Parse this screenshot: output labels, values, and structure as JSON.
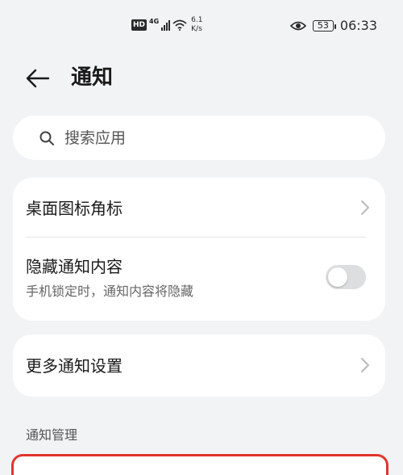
{
  "status_bar": {
    "hd": "HD",
    "network": "4G",
    "speed_value": "6.1",
    "speed_unit": "K/s",
    "battery": "53",
    "time": "06:33"
  },
  "header": {
    "title": "通知"
  },
  "search": {
    "placeholder": "搜索应用"
  },
  "settings": {
    "desktop_badge": "桌面图标角标",
    "hide_content": "隐藏通知内容",
    "hide_content_desc": "手机锁定时，通知内容将隐藏",
    "hide_content_enabled": false,
    "more_settings": "更多通知设置"
  },
  "section": {
    "title": "通知管理"
  },
  "colors": {
    "background": "#f1f3f5",
    "card": "#ffffff",
    "highlight_border": "#e2352d"
  }
}
